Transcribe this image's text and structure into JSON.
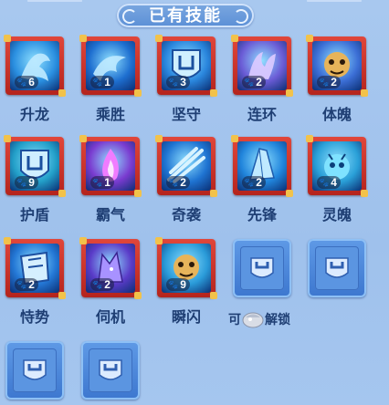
{
  "header": {
    "title": "已有技能"
  },
  "skills": [
    {
      "name": "升龙",
      "level": "6",
      "icon": "dragon-icon",
      "color": "#2a8fe0"
    },
    {
      "name": "乘胜",
      "level": "1",
      "icon": "wave-icon",
      "color": "#1e6fd0"
    },
    {
      "name": "坚守",
      "level": "3",
      "icon": "shield-icon",
      "color": "#2a86dd"
    },
    {
      "name": "连环",
      "level": "2",
      "icon": "claw-icon",
      "color": "#6b5cd6"
    },
    {
      "name": "体魄",
      "level": "2",
      "icon": "beast-icon",
      "color": "#3c6fd6"
    },
    {
      "name": "护盾",
      "level": "9",
      "icon": "shield-icon",
      "color": "#23a0c9"
    },
    {
      "name": "霸气",
      "level": "1",
      "icon": "flame-icon",
      "color": "#7a3bd0"
    },
    {
      "name": "奇袭",
      "level": "2",
      "icon": "slash-icon",
      "color": "#1f74d2"
    },
    {
      "name": "先锋",
      "level": "2",
      "icon": "crystal-icon",
      "color": "#2185dc"
    },
    {
      "name": "灵魄",
      "level": "4",
      "icon": "spirit-icon",
      "color": "#2aa0d8"
    },
    {
      "name": "恃势",
      "level": "2",
      "icon": "armor-icon",
      "color": "#2478d6"
    },
    {
      "name": "伺机",
      "level": "2",
      "icon": "wolf-icon",
      "color": "#5a3bc8"
    },
    {
      "name": "瞬闪",
      "level": "9",
      "icon": "beast-icon",
      "color": "#2a9bd9"
    }
  ],
  "unlock_text": {
    "left": "可",
    "right": "解锁"
  },
  "locked_slots": 4
}
